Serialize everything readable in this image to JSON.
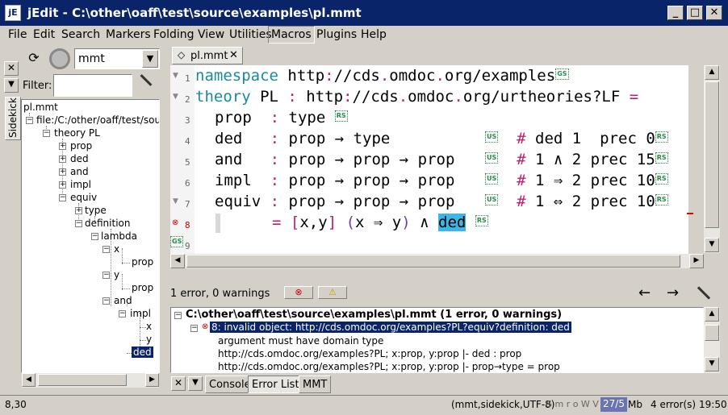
{
  "window": {
    "title": "jEdit - C:\\other\\oaff\\test\\source\\examples\\pl.mmt",
    "icon": "jedit-icon"
  },
  "menu": [
    "File",
    "Edit",
    "Search",
    "Markers",
    "Folding",
    "View",
    "Utilities",
    "Macros",
    "Plugins",
    "Help"
  ],
  "sidekick": {
    "vertical_tab": "Sidekick",
    "mode": "mmt",
    "filter_label": "Filter:",
    "filter_value": "",
    "tree": {
      "root": "pl.mmt",
      "file": "file:/C:/other/oaff/test/sou",
      "theory": "theory PL",
      "items": [
        "prop",
        "ded",
        "and",
        "impl",
        "equiv"
      ],
      "equiv_children": [
        "type",
        "definition"
      ],
      "lambda": "lambda",
      "lambda_children": [
        {
          "var": "x",
          "type": "prop"
        },
        {
          "var": "y",
          "type": "prop"
        }
      ],
      "and": "and",
      "impl": "impl",
      "impl_children": [
        "x",
        "y"
      ],
      "selected": "ded"
    }
  },
  "editor": {
    "tab": "pl.mmt",
    "lines": [
      {
        "n": "1",
        "text": "namespace http://cds.omdoc.org/examples",
        "tags": [
          "GS"
        ]
      },
      {
        "n": "2",
        "text": "theory PL : http://cds.omdoc.org/urtheories?LF =",
        "tags": []
      },
      {
        "n": "3",
        "name": "prop",
        "type": "type",
        "tags": [
          "RS"
        ]
      },
      {
        "n": "4",
        "name": "ded",
        "type": "prop → type",
        "notation": "# ded 1  prec 0",
        "tags": [
          "US",
          "RS"
        ]
      },
      {
        "n": "5",
        "name": "and",
        "type": "prop → prop → prop",
        "notation": "# 1 ∧ 2 prec 15",
        "tags": [
          "US",
          "RS"
        ]
      },
      {
        "n": "6",
        "name": "impl",
        "type": "prop → prop → prop",
        "notation": "# 1 ⇒ 2 prec 10",
        "tags": [
          "US",
          "RS"
        ]
      },
      {
        "n": "7",
        "name": "equiv",
        "type": "prop → prop → prop",
        "notation": "# 1 ⇔ 2 prec 10",
        "tags": [
          "US",
          "RS"
        ]
      },
      {
        "n": "8",
        "def": "= [x,y] (x ⇒ y) ∧ ded",
        "tags": [
          "RS"
        ]
      },
      {
        "n": "9",
        "tags": [
          "GS"
        ]
      }
    ]
  },
  "errorlist": {
    "summary": "1 error, 0 warnings",
    "file_node": "C:\\other\\oaff\\test\\source\\examples\\pl.mmt (1 error, 0 warnings)",
    "error": "8: invalid object: http://cds.omdoc.org/examples?PL?equiv?definition: ded",
    "details": [
      "argument must have domain type",
      "http://cds.omdoc.org/examples?PL; x:prop, y:prop |- ded : prop",
      "http://cds.omdoc.org/examples?PL; x:prop, y:prop |- prop→type = prop"
    ]
  },
  "bottom_tabs": [
    "Console",
    "Error List",
    "MMT"
  ],
  "status": {
    "caret": "8,30",
    "mode_info": "(mmt,sidekick,UTF-8)",
    "flags": "S m r o W V",
    "memory": "27/5",
    "memory_unit": "Mb",
    "errors": "4 error(s)",
    "time": "19:50"
  }
}
